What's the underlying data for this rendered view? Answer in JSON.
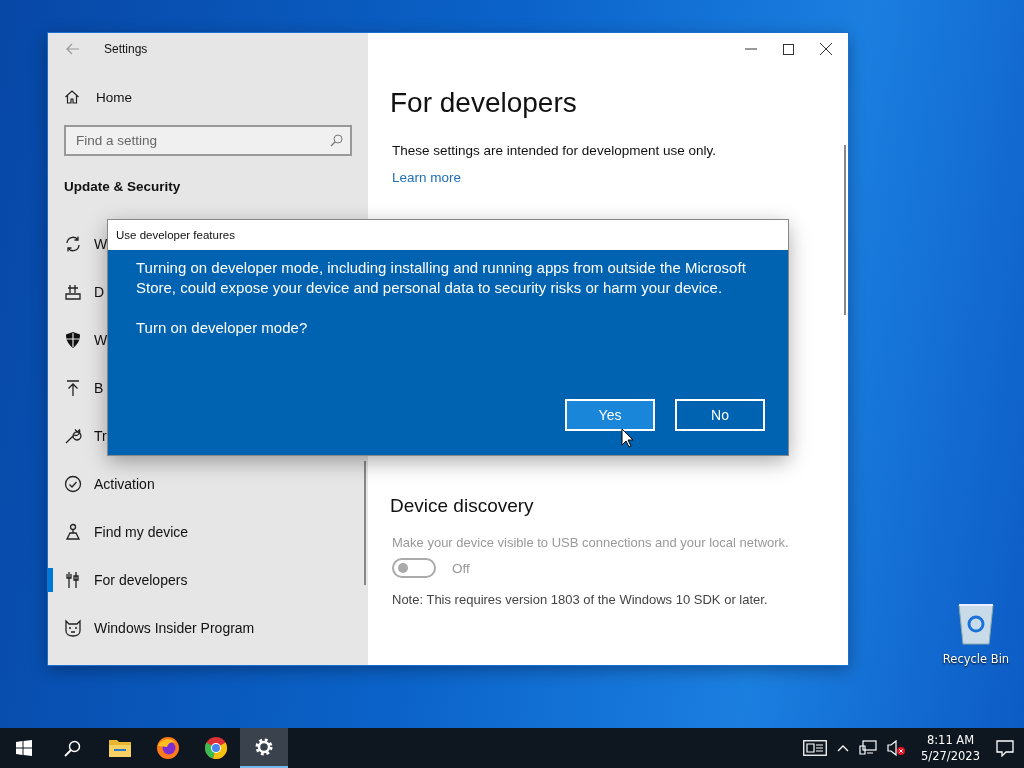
{
  "window": {
    "title": "Settings"
  },
  "sidebar": {
    "home": "Home",
    "search": {
      "placeholder": "Find a setting"
    },
    "section": "Update & Security",
    "items": [
      {
        "label": "W",
        "selected": false
      },
      {
        "label": "D",
        "selected": false
      },
      {
        "label": "W",
        "selected": false
      },
      {
        "label": "B",
        "selected": false
      },
      {
        "label": "Tr",
        "selected": false
      },
      {
        "label": "Activation",
        "selected": false
      },
      {
        "label": "Find my device",
        "selected": false
      },
      {
        "label": "For developers",
        "selected": true
      },
      {
        "label": "Windows Insider Program",
        "selected": false
      }
    ]
  },
  "content": {
    "title": "For developers",
    "intro": "These settings are intended for development use only.",
    "link": "Learn more",
    "sections": [
      {
        "heading": "Device discovery",
        "description": "Make your device visible to USB connections and your local network.",
        "toggle": {
          "on": false,
          "disabled": true,
          "label": "Off"
        },
        "note": "Note: This requires version 1803 of the Windows 10 SDK or later."
      }
    ]
  },
  "dialog": {
    "title": "Use developer features",
    "message": "Turning on developer mode, including installing and running apps from outside the Microsoft Store, could expose your device and personal data to security risks or harm your device.",
    "question": "Turn on developer mode?",
    "buttons": [
      {
        "label": "Yes",
        "selected": true
      },
      {
        "label": "No",
        "selected": false
      }
    ]
  },
  "desktop": {
    "icons": [
      {
        "label": "Recycle Bin"
      }
    ]
  },
  "taskbar": {
    "apps": [
      {
        "selected": false
      },
      {
        "selected": false
      },
      {
        "selected": false
      },
      {
        "selected": true
      }
    ],
    "time": "8:11 AM",
    "date": "5/27/2023"
  }
}
